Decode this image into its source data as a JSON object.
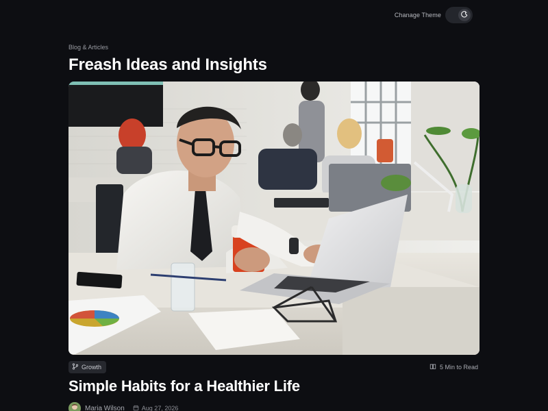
{
  "header": {
    "theme_label": "Chanage Theme",
    "theme_icon": "moon-icon"
  },
  "section": {
    "eyebrow": "Blog & Articles",
    "title": "Freash Ideas and Insights"
  },
  "article": {
    "image_alt": "Man in glasses working on laptop with coffee in office",
    "tag": {
      "icon": "branch-icon",
      "label": "Growth"
    },
    "read_time": {
      "icon": "book-icon",
      "label": "5 Min to Read"
    },
    "title": "Simple Habits for a Healthier Life",
    "author": "Maria Wilson",
    "date_icon": "calendar-icon",
    "date": "Aug 27, 2026"
  },
  "colors": {
    "background": "#0d0e12",
    "text": "#ffffff",
    "muted": "#9a9ca3",
    "tag_bg": "#26282e"
  }
}
